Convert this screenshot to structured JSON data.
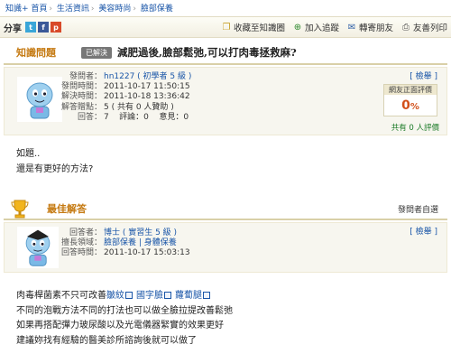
{
  "breadcrumb": [
    "知識+ 首頁",
    "生活資訊",
    "美容時尚",
    "臉部保養"
  ],
  "toolbar": {
    "share_label": "分享",
    "share_icons": [
      "twitter-icon",
      "facebook-icon",
      "plurk-icon"
    ],
    "actions": [
      {
        "label": "收藏至知識圈",
        "icon": "collect-icon"
      },
      {
        "label": "加入追蹤",
        "icon": "follow-icon"
      },
      {
        "label": "轉寄朋友",
        "icon": "mail-icon"
      },
      {
        "label": "友善列印",
        "icon": "print-icon"
      }
    ]
  },
  "question": {
    "section_label": "知識問題",
    "status_badge": "已解決",
    "title": "減肥過後,臉部鬆弛,可以打肉毒拯救麻?",
    "meta": [
      {
        "key": "發問者：",
        "value": "hn1227 ( 初學者 5 級 )"
      },
      {
        "key": "發問時間：",
        "value": "2011-10-17 11:50:15"
      },
      {
        "key": "解決時間：",
        "value": "2011-10-18 13:36:42"
      },
      {
        "key": "解答贈點：",
        "value": "5 ( 共有 0 人贊助 )"
      },
      {
        "key": "回答：",
        "value": "7    評論：0    意見：0"
      }
    ],
    "report": "[ 檢舉 ]",
    "rating_header": "網友正面評價",
    "rating_value": "0",
    "rating_unit": "%",
    "rating_footer": "共有 0 人評價",
    "body": [
      "如題..",
      "還是有更好的方法?"
    ]
  },
  "best_answer": {
    "label": "最佳解答",
    "picked_by": "發問者自選",
    "report": "[ 檢舉 ]",
    "meta": [
      {
        "key": "回答者：",
        "value": "博士 ( 實習生 5 級 )"
      },
      {
        "key": "擅長領域：",
        "value": "臉部保養 | 身體保養"
      },
      {
        "key": "回答時間：",
        "value": "2011-10-17 15:03:13"
      }
    ],
    "line1_prefix": "肉毒桿菌素不只可改善",
    "keywords": [
      "皺紋",
      "國字臉",
      "蘿蔔腿"
    ],
    "lines": [
      "不同的泡戰方法不同的打法也可以做全臉拉提改善鬆弛",
      "如果再搭配彈力玻尿酸以及光電儀器緊實的效果更好",
      "建議妳找有經驗的醫美診所諮詢後就可以做了"
    ]
  }
}
